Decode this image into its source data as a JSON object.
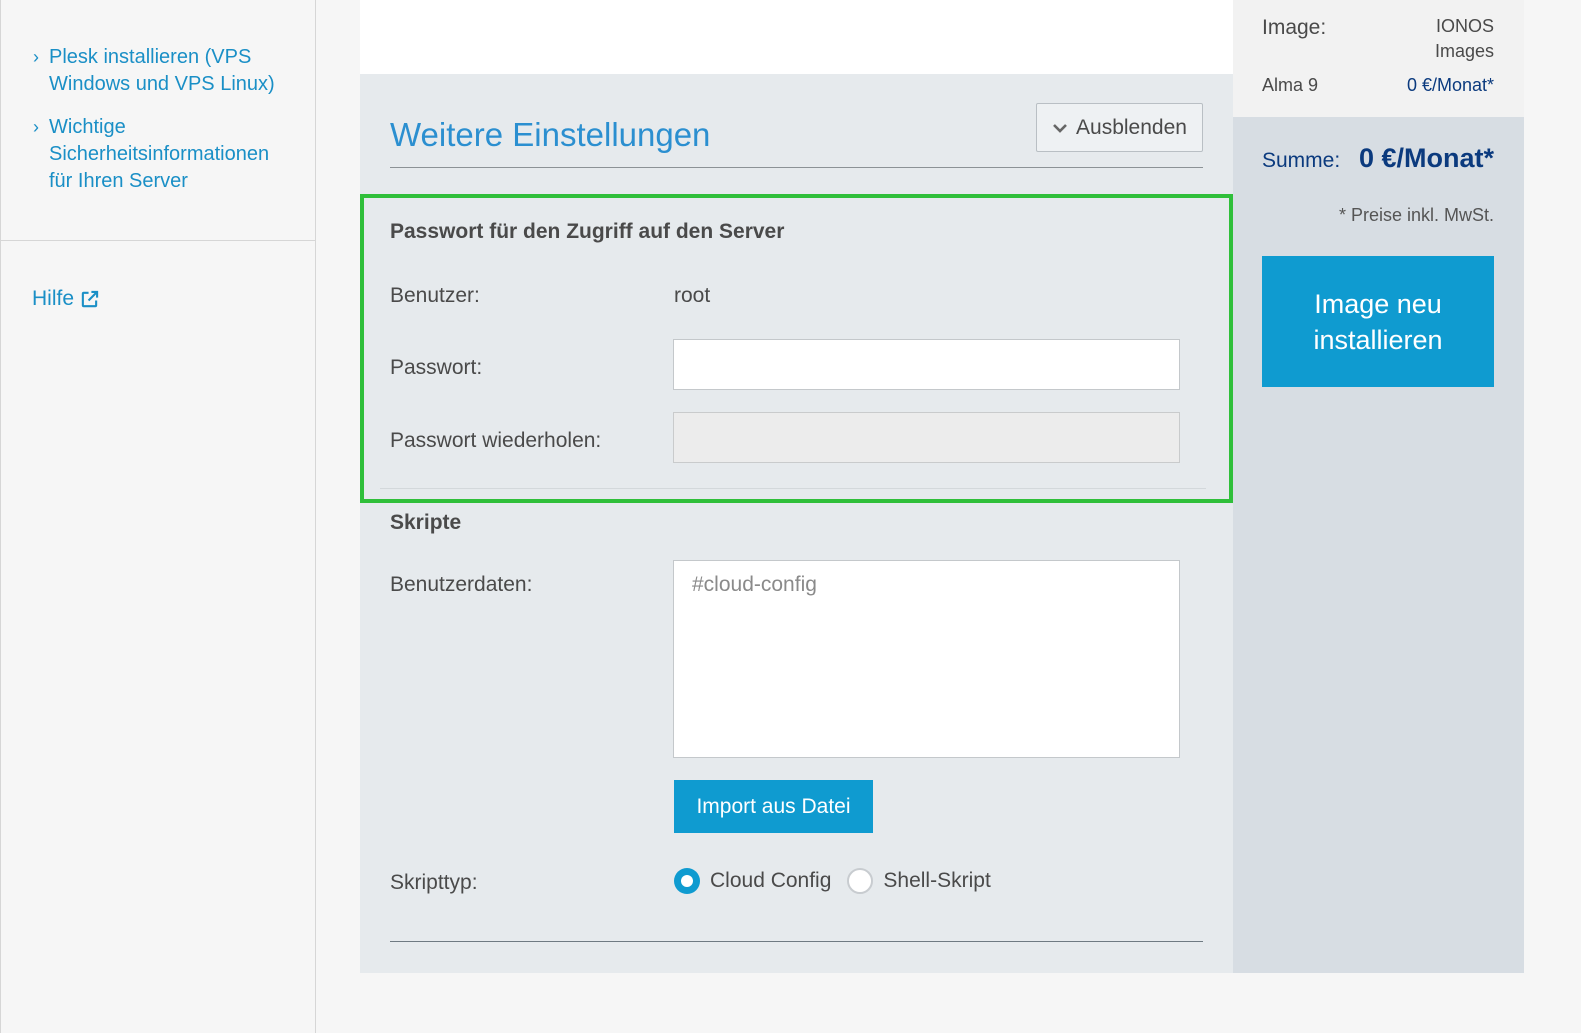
{
  "sidebar": {
    "links": [
      {
        "label": "Plesk installieren (VPS Windows und VPS Linux)",
        "icon": "chevron-right-icon"
      },
      {
        "label": "Wichtige Sicherheitsinformationen für Ihren Server",
        "icon": "chevron-right-icon"
      }
    ],
    "help": {
      "label": "Hilfe",
      "icon": "external-link-icon"
    }
  },
  "settings": {
    "title": "Weitere Einstellungen",
    "toggle_label": "Ausblenden",
    "toggle_icon": "chevron-down-icon",
    "password_section": {
      "heading": "Passwort für den Zugriff auf den Server",
      "user_label": "Benutzer:",
      "user_value": "root",
      "password_label": "Passwort:",
      "password_value": "",
      "repeat_label": "Passwort wiederholen:",
      "repeat_value": ""
    },
    "scripts_section": {
      "heading": "Skripte",
      "userdata_label": "Benutzerdaten:",
      "userdata_placeholder": "#cloud-config",
      "import_label": "Import aus Datei",
      "scripttype_label": "Skripttyp:",
      "options": [
        {
          "label": "Cloud Config",
          "selected": true
        },
        {
          "label": "Shell-Skript",
          "selected": false
        }
      ]
    }
  },
  "summary": {
    "image_label": "Image:",
    "image_value_line1": "IONOS",
    "image_value_line2": "Images",
    "os_name": "Alma 9",
    "os_price": "0 €/Monat*",
    "sum_label": "Summe:",
    "sum_value": "0 €/Monat*",
    "note": "* Preise inkl. MwSt.",
    "install_label": "Image neu installieren"
  },
  "colors": {
    "accent": "#0f9bd0",
    "title_blue": "#2b8fd0",
    "price_navy": "#0b3a7e",
    "highlight_green": "#2fbf3a"
  }
}
